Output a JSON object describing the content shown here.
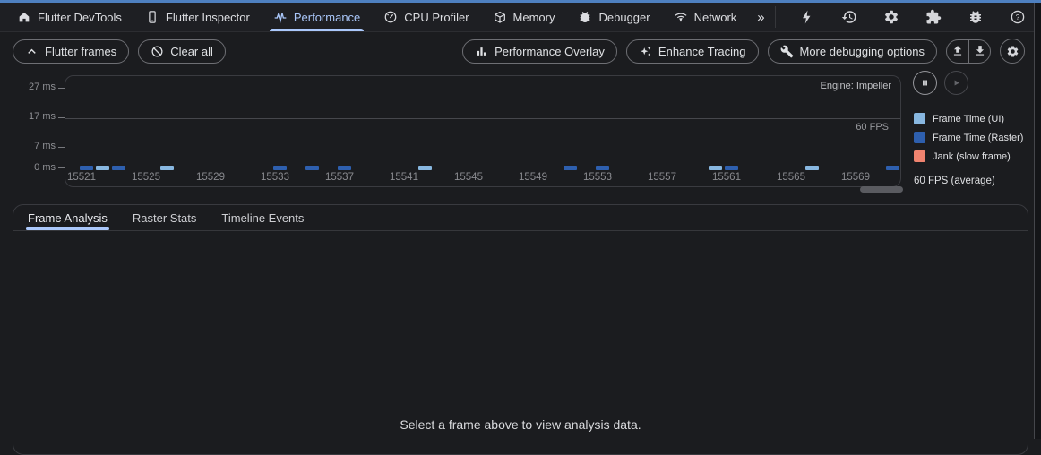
{
  "colors": {
    "accent": "#ABC8FB",
    "top_strip": "#4E80C0",
    "frame_time_ui": "#88B7E0",
    "frame_time_raster": "#2E5FAE",
    "jank": "#F0836F"
  },
  "nav": {
    "items": [
      {
        "label": "Flutter DevTools",
        "icon": "home-icon",
        "selected": false
      },
      {
        "label": "Flutter Inspector",
        "icon": "phone-icon",
        "selected": false
      },
      {
        "label": "Performance",
        "icon": "pulse-icon",
        "selected": true
      },
      {
        "label": "CPU Profiler",
        "icon": "gauge-icon",
        "selected": false
      },
      {
        "label": "Memory",
        "icon": "package-icon",
        "selected": false
      },
      {
        "label": "Debugger",
        "icon": "bug-icon",
        "selected": false
      },
      {
        "label": "Network",
        "icon": "network-icon",
        "selected": false
      }
    ],
    "overflow_label": "»",
    "action_icons": [
      "lightning-icon",
      "history-icon",
      "gear-icon",
      "extensions-icon",
      "bug-report-icon",
      "help-icon"
    ]
  },
  "toolbar": {
    "flutter_frames_label": "Flutter frames",
    "clear_all_label": "Clear all",
    "performance_overlay_label": "Performance Overlay",
    "enhance_tracing_label": "Enhance Tracing",
    "more_debugging_label": "More debugging options",
    "icon_names": [
      "chevron-up-icon",
      "block-icon",
      "bar-chart-icon",
      "sparkle-icon",
      "wrench-icon",
      "upload-icon",
      "download-icon",
      "gear-icon"
    ]
  },
  "chart_data": {
    "type": "bar",
    "title": "Flutter frames chart",
    "engine_label": "Engine: Impeller",
    "fps_line_label": "60 FPS",
    "fps_line_ms": 17,
    "y_unit": "ms",
    "y_ticks": [
      {
        "ms": 27,
        "label": "27 ms"
      },
      {
        "ms": 17,
        "label": "17 ms"
      },
      {
        "ms": 7,
        "label": "7 ms"
      },
      {
        "ms": 0,
        "label": "0 ms"
      }
    ],
    "x_start_frame": 15521,
    "x_ticks": [
      15521,
      15525,
      15529,
      15533,
      15537,
      15541,
      15545,
      15549,
      15553,
      15557,
      15561,
      15565,
      15569
    ],
    "series_colors": {
      "ui": "#88B7E0",
      "raster": "#2E5FAE",
      "jank": "#F0836F"
    },
    "bars": [
      {
        "frame": 15521,
        "series": "raster",
        "ms": 1.5
      },
      {
        "frame": 15522,
        "series": "ui",
        "ms": 1.5
      },
      {
        "frame": 15523,
        "series": "raster",
        "ms": 1.5
      },
      {
        "frame": 15526,
        "series": "ui",
        "ms": 1.5
      },
      {
        "frame": 15533,
        "series": "raster",
        "ms": 1.5
      },
      {
        "frame": 15535,
        "series": "raster",
        "ms": 1.5
      },
      {
        "frame": 15537,
        "series": "raster",
        "ms": 1.5
      },
      {
        "frame": 15542,
        "series": "ui",
        "ms": 1.5
      },
      {
        "frame": 15551,
        "series": "raster",
        "ms": 1.5
      },
      {
        "frame": 15553,
        "series": "raster",
        "ms": 1.5
      },
      {
        "frame": 15560,
        "series": "ui",
        "ms": 1.5
      },
      {
        "frame": 15561,
        "series": "raster",
        "ms": 1.5
      },
      {
        "frame": 15566,
        "series": "ui",
        "ms": 1.5
      },
      {
        "frame": 15571,
        "series": "raster",
        "ms": 1.5
      }
    ]
  },
  "legend": {
    "items": [
      {
        "label": "Frame Time (UI)",
        "color": "#88B7E0"
      },
      {
        "label": "Frame Time (Raster)",
        "color": "#2E5FAE"
      },
      {
        "label": "Jank (slow frame)",
        "color": "#F0836F"
      }
    ],
    "average_label": "60 FPS (average)"
  },
  "panel": {
    "tabs": [
      {
        "label": "Frame Analysis",
        "selected": true
      },
      {
        "label": "Raster Stats",
        "selected": false
      },
      {
        "label": "Timeline Events",
        "selected": false
      }
    ],
    "message": "Select a frame above to view analysis data."
  }
}
